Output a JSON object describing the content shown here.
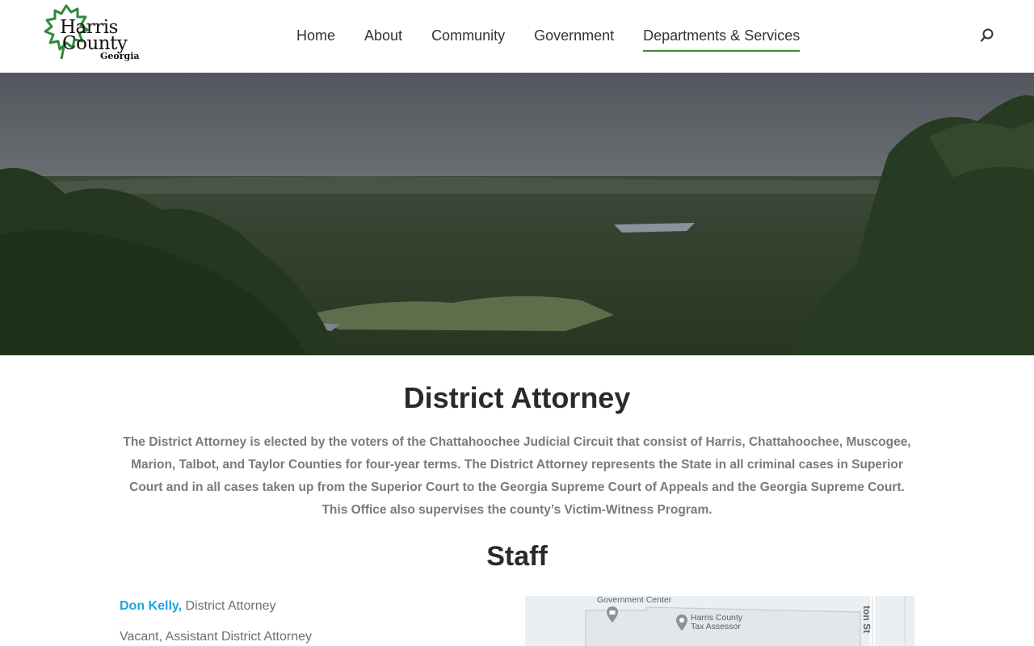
{
  "logo": {
    "line1": "Harris",
    "line2": "County",
    "line3": "Georgia"
  },
  "nav": {
    "items": [
      {
        "label": "Home"
      },
      {
        "label": "About"
      },
      {
        "label": "Community"
      },
      {
        "label": "Government"
      },
      {
        "label": "Departments & Services",
        "active": true
      }
    ]
  },
  "page": {
    "title": "District Attorney",
    "intro": "The District Attorney is elected by the voters of the Chattahoochee Judicial Circuit that consist of Harris, Chattahoochee, Muscogee, Marion, Talbot, and Taylor Counties for four-year terms. The District Attorney represents the State in all criminal cases in Superior Court and in all cases taken up from the Superior Court to the Georgia Supreme Court of Appeals and the Georgia Supreme Court. This Office also supervises the county’s Victim-Witness Program.",
    "staff_title": "Staff"
  },
  "staff": [
    {
      "name": "Don Kelly,",
      "role": " District Attorney"
    },
    {
      "role": "Vacant, Assistant District Attorney"
    }
  ],
  "map": {
    "label_center": "Government Center",
    "label_tax_line1": "Harris County",
    "label_tax_line2": "Tax Assessor",
    "label_street": "ton St"
  },
  "colors": {
    "accent_green": "#3a8a2e",
    "link_blue": "#1ea5e0"
  }
}
